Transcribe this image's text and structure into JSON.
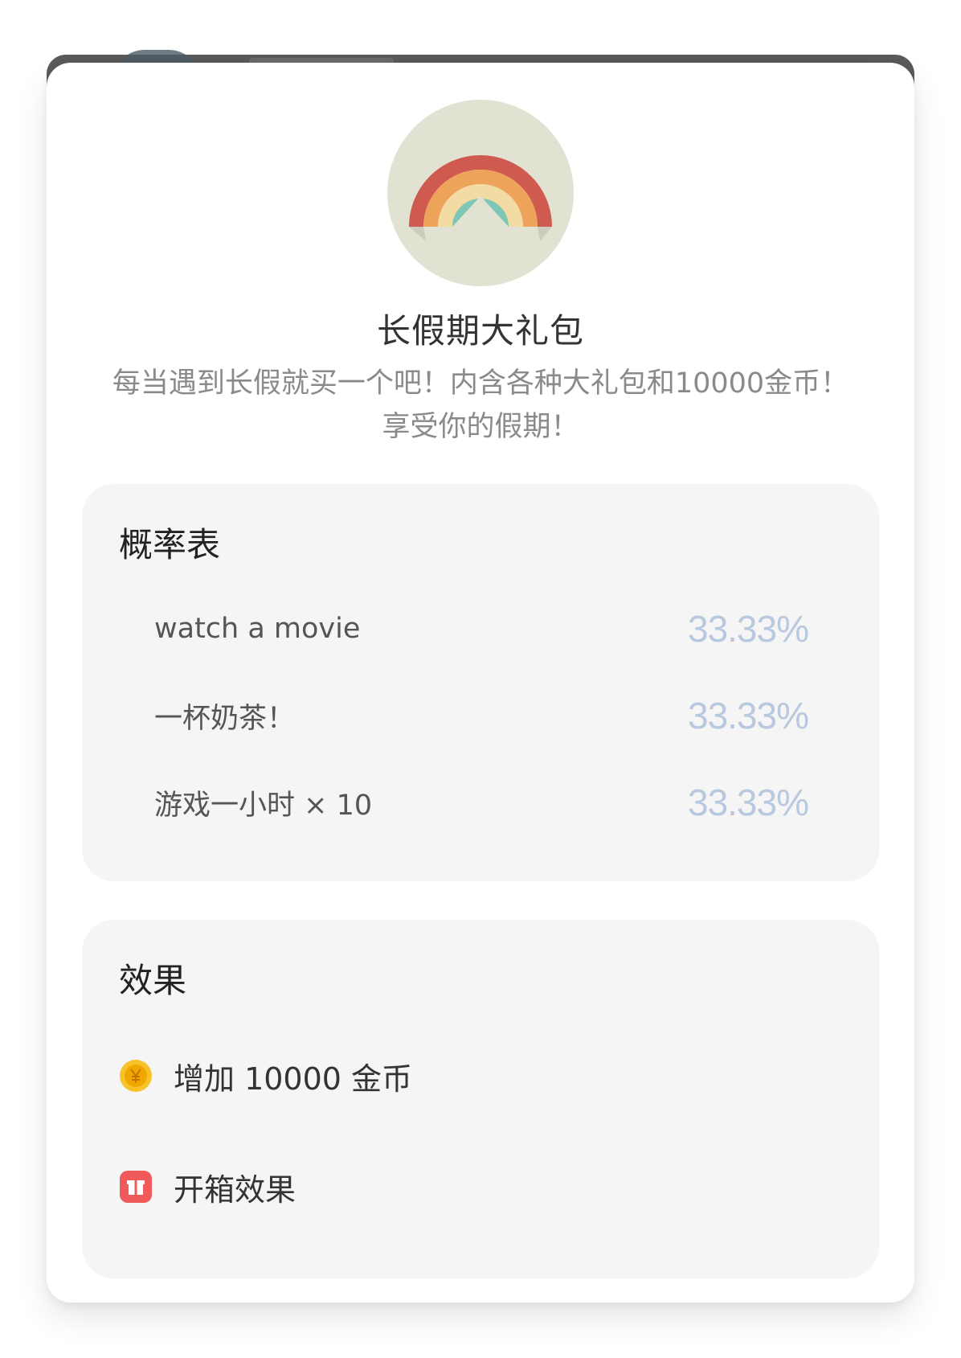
{
  "dialog": {
    "title": "长假期大礼包",
    "description": "每当遇到长假就买一个吧！内含各种大礼包和10000金币！享受你的假期！",
    "badge_icon": "rainbow-icon"
  },
  "probability_table": {
    "heading": "概率表",
    "items": [
      {
        "name": "watch a movie",
        "value": "33.33%"
      },
      {
        "name": "一杯奶茶！",
        "value": "33.33%"
      },
      {
        "name": "游戏一小时 × 10",
        "value": "33.33%"
      }
    ]
  },
  "effects": {
    "heading": "效果",
    "items": [
      {
        "icon": "coin-icon",
        "label": "增加 10000 金币"
      },
      {
        "icon": "gift-box-icon",
        "label": "开箱效果"
      }
    ]
  },
  "colors": {
    "percent": "#b8c8de",
    "panel": "#f5f5f5",
    "coin": "#f5b800",
    "gift": "#f05a5a"
  }
}
